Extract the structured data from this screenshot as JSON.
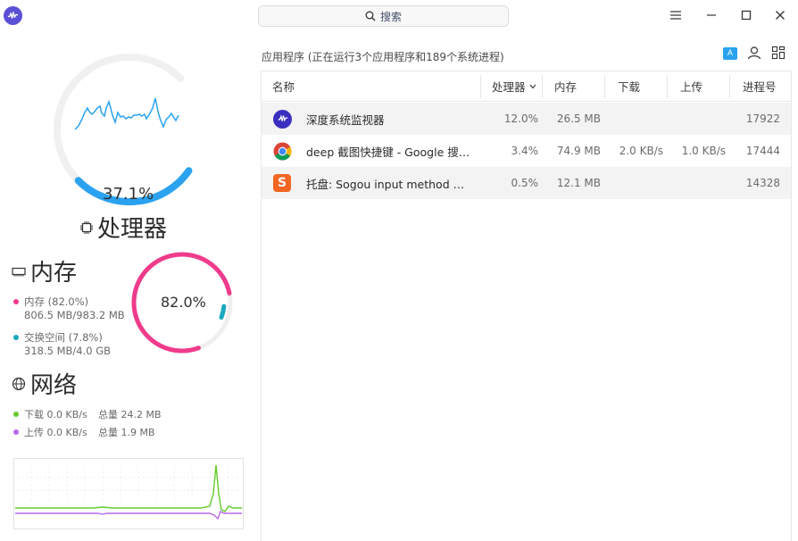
{
  "window": {
    "search_placeholder": "搜索"
  },
  "cpu": {
    "percent_text": "37.1%",
    "percent_value": 37.1,
    "title": "处理器",
    "color": "#2aa2f0"
  },
  "memory": {
    "title": "内存",
    "ring_percent_text": "82.0%",
    "mem_percent": 82.0,
    "swap_percent": 7.8,
    "mem_label": "内存 (82.0%)",
    "mem_detail": "806.5 MB/983.2 MB",
    "swap_label": "交换空间 (7.8%)",
    "swap_detail": "318.5 MB/4.0 GB",
    "mem_color": "#ef3b8c",
    "swap_color": "#1aa8c0"
  },
  "network": {
    "title": "网络",
    "download_label": "下载 0.0 KB/s",
    "download_total": "总量 24.2 MB",
    "upload_label": "上传 0.0 KB/s",
    "upload_total": "总量 1.9 MB",
    "download_color": "#63cc2b",
    "upload_color": "#b868e8"
  },
  "processes": {
    "header": "应用程序 (正在运行3个应用程序和189个系统进程)",
    "columns": {
      "name": "名称",
      "cpu": "处理器",
      "memory": "内存",
      "download": "下载",
      "upload": "上传",
      "pid": "进程号"
    },
    "rows": [
      {
        "icon": "deepin-monitor-icon",
        "name": "深度系统监视器",
        "cpu": "12.0%",
        "memory": "26.5 MB",
        "download": "",
        "upload": "",
        "pid": "17922"
      },
      {
        "icon": "chrome-icon",
        "name": "deep 截图快捷键 - Google 搜…",
        "cpu": "3.4%",
        "memory": "74.9 MB",
        "download": "2.0 KB/s",
        "upload": "1.0 KB/s",
        "pid": "17444"
      },
      {
        "icon": "sogou-icon",
        "name": "托盘: Sogou input method  …",
        "cpu": "0.5%",
        "memory": "12.1 MB",
        "download": "",
        "upload": "",
        "pid": "14328"
      }
    ]
  }
}
